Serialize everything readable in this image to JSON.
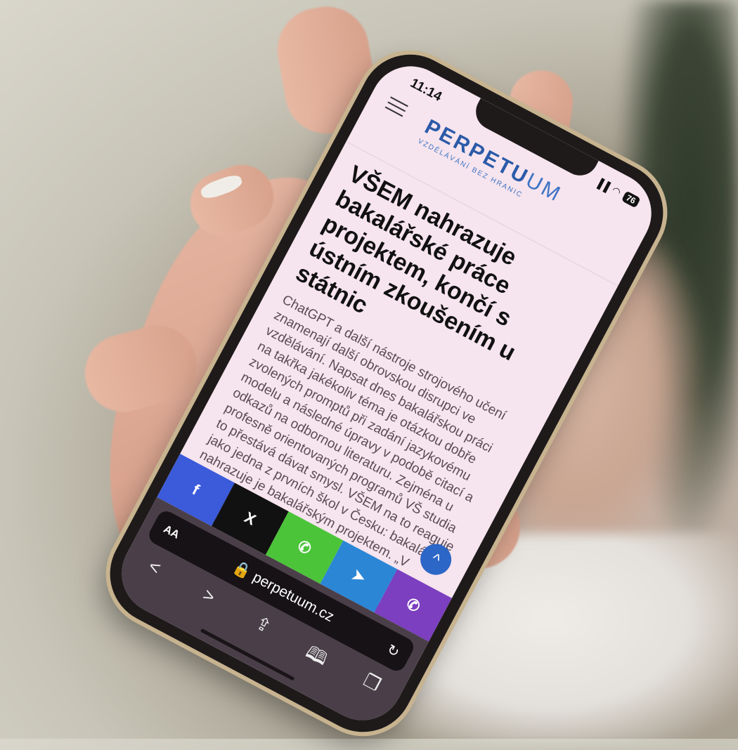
{
  "status_bar": {
    "time": "11:14",
    "signal": "▐▐",
    "wifi": "◠",
    "battery": "76"
  },
  "site": {
    "menu_icon": "hamburger-icon",
    "logo_bold": "PERPETU",
    "logo_light": "UM",
    "logo_tagline": "VZDĚLÁVÁNÍ BEZ HRANIC"
  },
  "article": {
    "headline": "VŠEM nahrazuje bakalářské práce projektem, končí s ústním zkoušením u státnic",
    "body": "ChatGPT a další nástroje strojového učení znamenají další obrovskou disrupci ve vzdělávání. Napsat dnes bakalářskou práci na takřka jakékoliv téma je otázkou dobře zvolených promptů při zadání jazykovému modelu a následné úpravy v podobě citací a odkazů na odbornou literaturu. Zejména u profesně orientovaných programů VŠ studia to přestává dávat smysl. VŠEM na to reaguje jako jedna z prvních škol v Česku: bakalářky nahrazuje je bakalářským projektem. „V případě VŠEM je to jednoznačný signál o dalším posunu ke kvalitnějšímu, užitečnějšímu vzdělávání, které nevyprchá s ukončením studia,\" konstatuje prorektor VŠEM Bohumil Kartous."
  },
  "share_bar": [
    {
      "name": "facebook-share-button",
      "label": "f",
      "color": "#3b5bdb"
    },
    {
      "name": "x-share-button",
      "label": "X",
      "color": "#111111"
    },
    {
      "name": "whatsapp-share-button",
      "label": "✆",
      "color": "#4cc43a"
    },
    {
      "name": "telegram-share-button",
      "label": "➤",
      "color": "#2b86d6"
    },
    {
      "name": "viber-share-button",
      "label": "✆",
      "color": "#7b3fbf"
    }
  ],
  "scroll_top": "^",
  "browser": {
    "aa_label": "AA",
    "url": "🔒 perpetuum.cz",
    "reload": "↻",
    "back": "<",
    "forward": ">",
    "share": "⇪",
    "bookmarks": "🕮",
    "tabs": "❐"
  }
}
